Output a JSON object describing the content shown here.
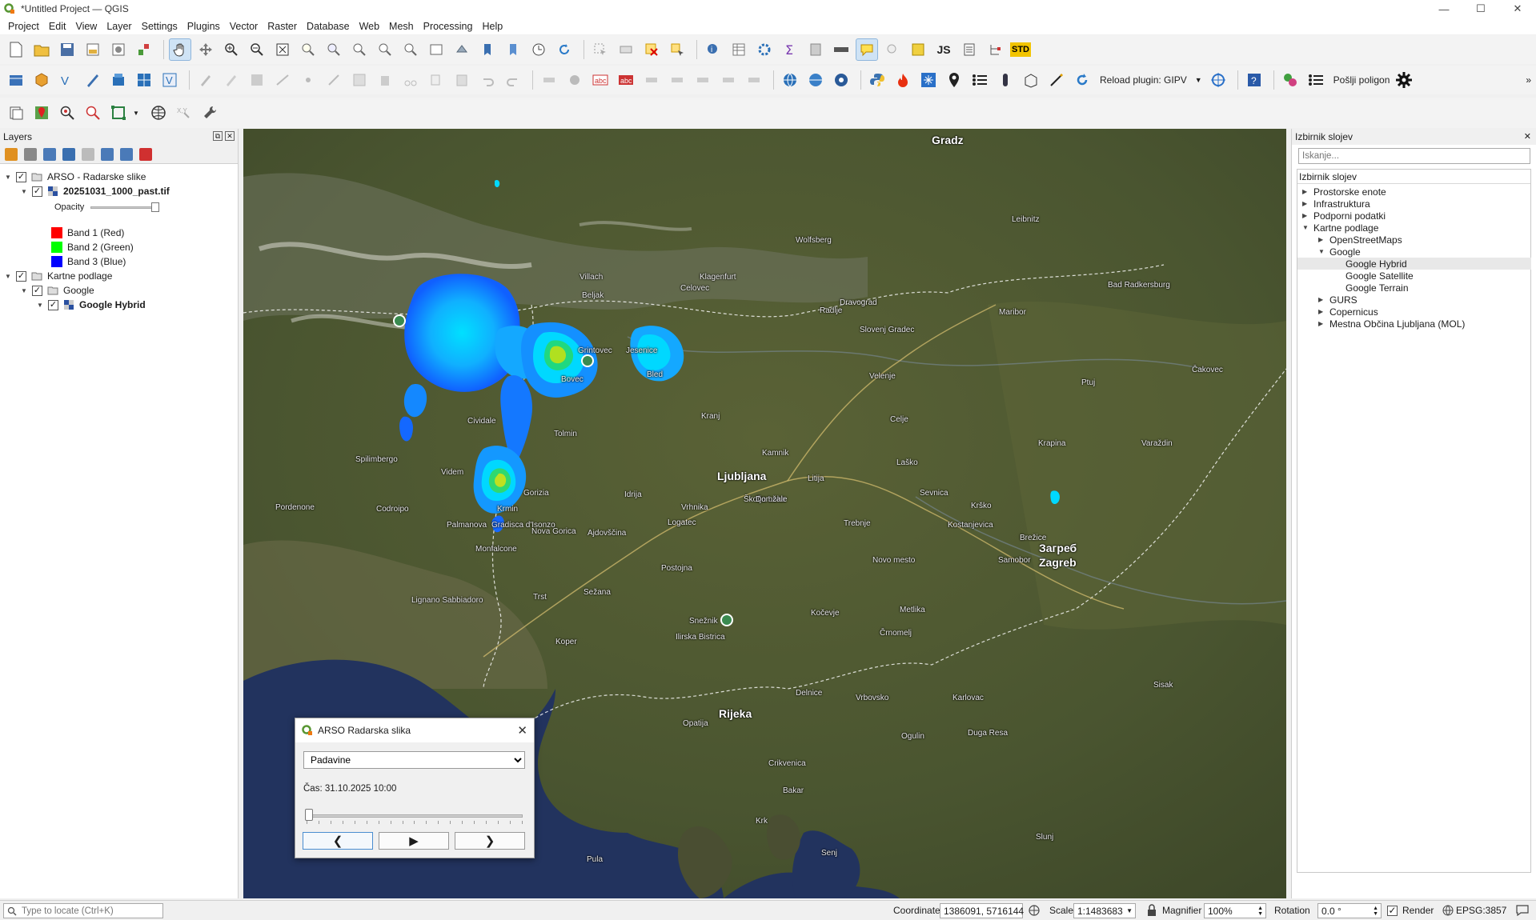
{
  "window": {
    "title": "*Untitled Project — QGIS",
    "min": "—",
    "max": "☐",
    "close": "✕"
  },
  "menu": [
    "Project",
    "Edit",
    "View",
    "Layer",
    "Settings",
    "Plugins",
    "Vector",
    "Raster",
    "Database",
    "Web",
    "Mesh",
    "Processing",
    "Help"
  ],
  "toolbar": {
    "js_label": "JS",
    "std_label": "STD",
    "reload_plugin_label": "Reload plugin: GIPV",
    "send_polygon_label": "Pošlji poligon"
  },
  "layers_panel": {
    "title": "Layers",
    "group1": {
      "label": "ARSO - Radarske slike"
    },
    "raster": {
      "label": "20251031_1000_past.tif",
      "opacity_label": "Opacity",
      "opacity": 1.0
    },
    "bands": [
      {
        "label": "Band 1 (Red)",
        "color": "#ff0000"
      },
      {
        "label": "Band 2 (Green)",
        "color": "#00ff00"
      },
      {
        "label": "Band 3 (Blue)",
        "color": "#0000ff"
      }
    ],
    "group2": {
      "label": "Kartne podlage"
    },
    "group3": {
      "label": "Google"
    },
    "layer": {
      "label": "Google Hybrid"
    }
  },
  "browser_panel": {
    "title": "Izbirnik slojev",
    "search_placeholder": "Iskanje...",
    "tree_header": "Izbirnik slojev",
    "items": [
      {
        "label": "Prostorske enote"
      },
      {
        "label": "Infrastruktura"
      },
      {
        "label": "Podporni podatki"
      },
      {
        "label": "Kartne podlage"
      },
      {
        "label": "OpenStreetMaps"
      },
      {
        "label": "Google"
      },
      {
        "label": "Google Hybrid"
      },
      {
        "label": "Google Satellite"
      },
      {
        "label": "Google Terrain"
      },
      {
        "label": "GURS"
      },
      {
        "label": "Copernicus"
      },
      {
        "label": "Mestna Občina Ljubljana (MOL)"
      }
    ]
  },
  "map": {
    "labels": [
      "Gradz",
      "Ljubljana",
      "Загреб",
      "Zagreb",
      "Maribor",
      "Celovec",
      "Beljak",
      "Videm",
      "Krmin",
      "Gradisca d'Isonzo",
      "Trst",
      "Koper",
      "Rijeka",
      "Kočevje",
      "Novo mesto",
      "Postojna",
      "Idrija",
      "Tolmin",
      "Bovec",
      "Kranj",
      "Celje",
      "Velenje",
      "Ptuj",
      "Krško",
      "Karlovac",
      "Pula",
      "Crikvenica",
      "Opatija",
      "Krk",
      "Bled",
      "Jesenice",
      "Klagenfurt",
      "Villach",
      "Grintovec",
      "Snežnik",
      "Lignano Sabbiadoro",
      "Monfalcone",
      "Gorizia",
      "Cividale",
      "Pordenone",
      "Spilimbergo",
      "Codroipo",
      "Palmanova",
      "Trebnje",
      "Krapina",
      "Varaždin",
      "Čakovec",
      "Slovenj Gradec",
      "Dravograd",
      "Wolfsberg",
      "Leibnitz",
      "Bad Radkersburg",
      "Radlje",
      "Kostanjevica",
      "Samobor",
      "Sisak",
      "Delnice",
      "Vrbovsko",
      "Ogulin",
      "Ilirska Bistrica",
      "Sežana",
      "Ajdovščina",
      "Nova Gorica",
      "Logatec",
      "Vrhnika",
      "Škofja Loka",
      "Kamnik",
      "Domžale",
      "Litija",
      "Laško",
      "Sevnica",
      "Brežice",
      "Metlika",
      "Črnomelj",
      "Duga Resa",
      "Slunj",
      "Senj",
      "Bakar"
    ]
  },
  "dialog": {
    "title": "ARSO Radarska slika",
    "product": "Padavine",
    "time_label": "Čas: 31.10.2025 10:00",
    "slider_position": 0,
    "prev": "❮",
    "play": "▶",
    "next": "❯",
    "close": "✕"
  },
  "statusbar": {
    "locator_placeholder": "Type to locate (Ctrl+K)",
    "coordinate_label": "Coordinate",
    "coordinate": "1386091, 5716144",
    "scale_label": "Scale",
    "scale": "1:1483683",
    "magnifier_label": "Magnifier",
    "magnifier": "100%",
    "rotation_label": "Rotation",
    "rotation": "0.0 °",
    "render_label": "Render",
    "crs": "EPSG:3857"
  }
}
